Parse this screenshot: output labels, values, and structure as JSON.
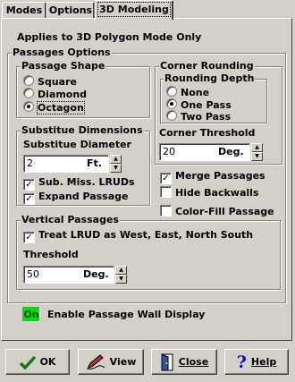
{
  "tabs": [
    {
      "label": "Modes"
    },
    {
      "label": "Options"
    },
    {
      "label": "3D Modeling"
    }
  ],
  "subtitle": "Applies to 3D Polygon Mode Only",
  "passages_options": {
    "title": "Passages Options",
    "passage_shape": {
      "title": "Passage Shape",
      "options": [
        "Square",
        "Diamond",
        "Octagon"
      ],
      "selected": "Octagon"
    },
    "corner_rounding": {
      "title": "Corner Rounding",
      "rounding_depth": {
        "title": "Rounding Depth",
        "options": [
          "None",
          "One Pass",
          "Two Pass"
        ],
        "selected": "One Pass"
      },
      "threshold_label": "Corner Threshold",
      "threshold_value": "20",
      "threshold_unit": "Deg."
    },
    "substitute_dimensions": {
      "title": "Substitue Dimensions",
      "diameter_label": "Substitue Diameter",
      "diameter_value": "2",
      "diameter_unit": "Ft.",
      "sub_miss_lruds": "Sub. Miss. LRUDs",
      "expand_passage": "Expand Passage"
    },
    "merge_passages": "Merge Passages",
    "hide_backwalls": "Hide Backwalls",
    "color_fill": "Color-Fill Passage",
    "vertical_passages": {
      "title": "Vertical Passages",
      "treat_lrud": "Treat LRUD as West, East, North South",
      "threshold_label": "Threshold",
      "threshold_value": "50",
      "threshold_unit": "Deg."
    }
  },
  "enable_wall": {
    "badge": "On",
    "label": "Enable Passage Wall Display"
  },
  "checks": {
    "sub_miss_lruds": true,
    "expand_passage": true,
    "merge_passages": true,
    "hide_backwalls": false,
    "color_fill": false,
    "treat_lrud": true
  },
  "buttons": {
    "ok": "OK",
    "view": "View",
    "close": "Close",
    "help": "Help"
  },
  "colors": {
    "face": "#d4d0c8",
    "on_badge": "#00e000",
    "ok_check": "#1a7a1a",
    "help_q": "#1010c0"
  }
}
